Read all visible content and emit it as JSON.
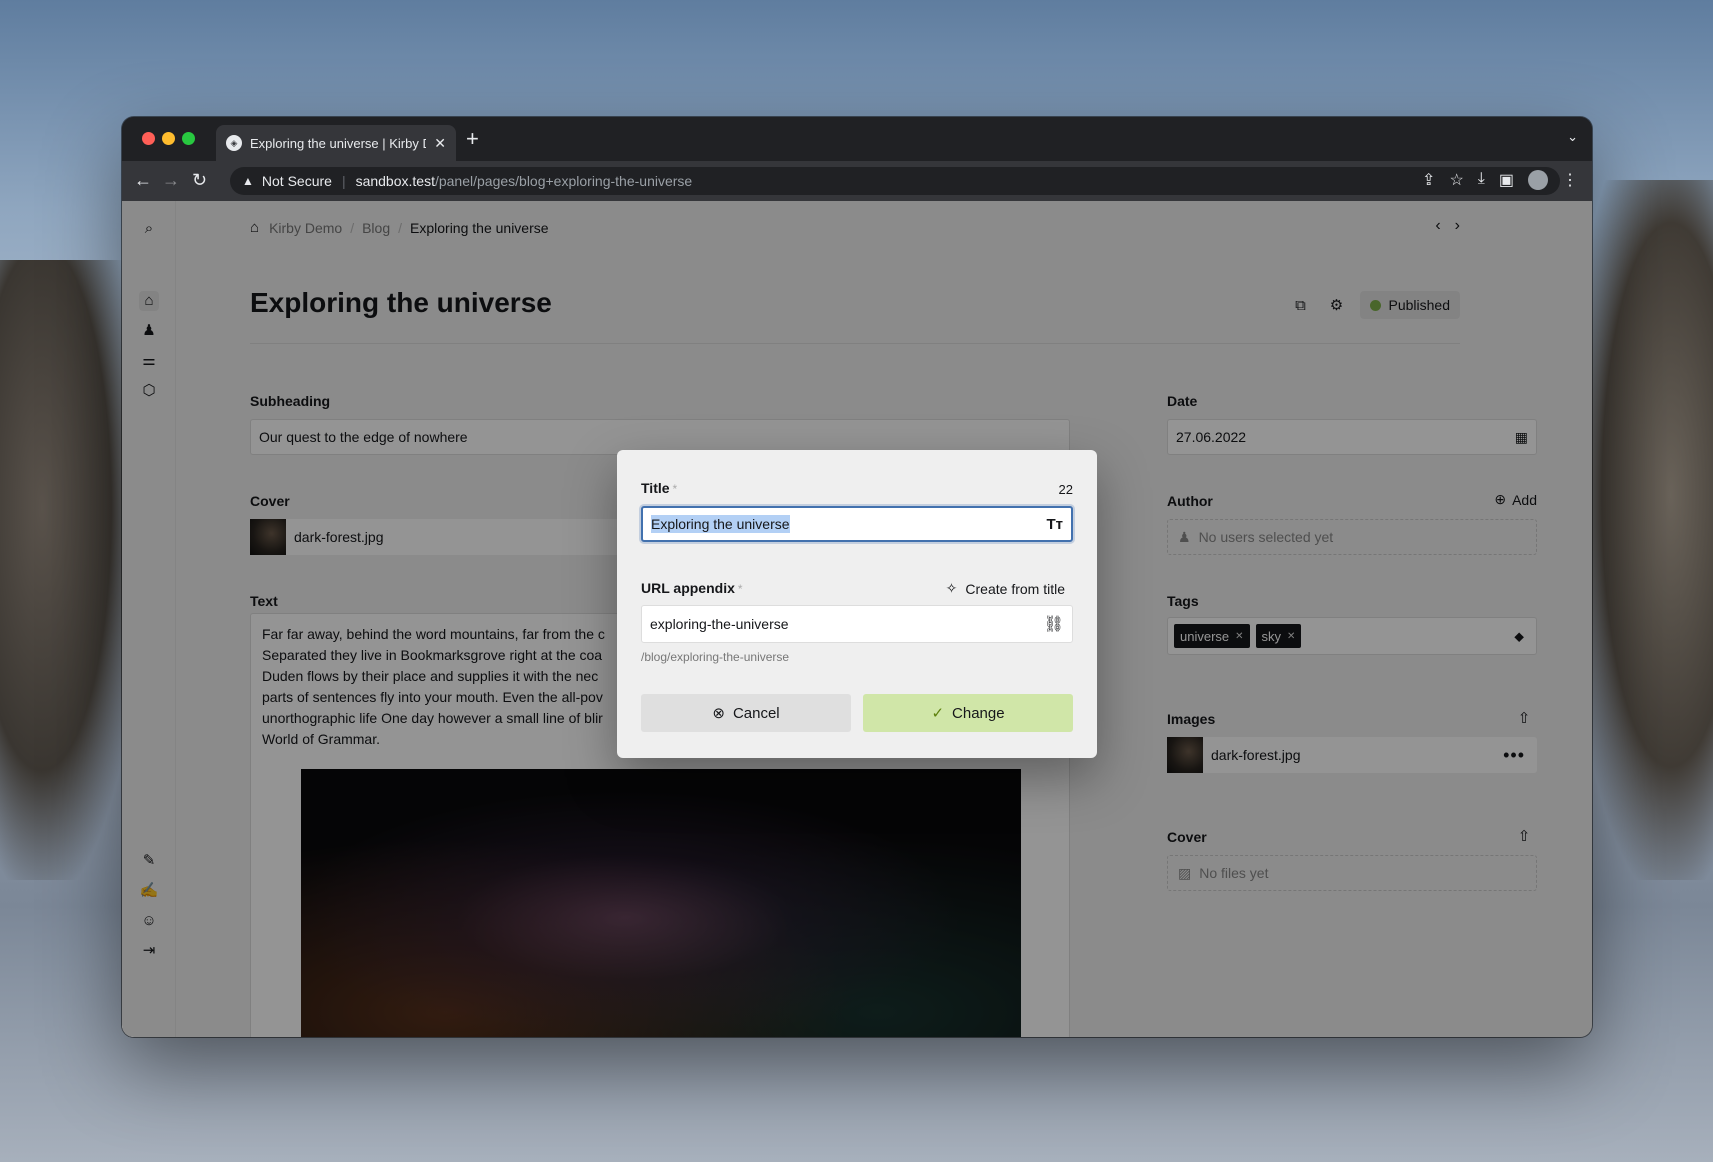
{
  "browser": {
    "tab_title": "Exploring the universe | Kirby D",
    "tab_close": "✕",
    "new_tab": "+",
    "not_secure": "Not Secure",
    "url_host": "sandbox.test",
    "url_path": "/panel/pages/blog+exploring-the-universe"
  },
  "breadcrumb": [
    "Kirby Demo",
    "Blog",
    "Exploring the universe"
  ],
  "page": {
    "title": "Exploring the universe",
    "status": "Published",
    "status_color": "#7fb04a"
  },
  "fields": {
    "subheading_label": "Subheading",
    "subheading_value": "Our quest to the edge of nowhere",
    "cover_label": "Cover",
    "cover_file": "dark-forest.jpg",
    "text_label": "Text",
    "text_lines": [
      "Far far away, behind the word mountains, far from the c",
      "Separated they live in Bookmarksgrove right at the coa",
      "Duden flows by their place and supplies it with the nec",
      "parts of sentences fly into your mouth. Even the all-pov",
      "unorthographic life One day however a small line of blir",
      "World of Grammar."
    ],
    "date_label": "Date",
    "date_value": "27.06.2022",
    "author_label": "Author",
    "author_add": "Add",
    "author_empty": "No users selected yet",
    "tags_label": "Tags",
    "tags": [
      "universe",
      "sky"
    ],
    "images_label": "Images",
    "images_file": "dark-forest.jpg",
    "cover2_label": "Cover",
    "cover2_empty": "No files yet"
  },
  "dialog": {
    "title_label": "Title",
    "required_mark": "*",
    "counter": "22",
    "title_value": "Exploring the universe",
    "url_label": "URL appendix",
    "create_from_title": "Create from title",
    "slug_value": "exploring-the-universe",
    "slug_help": "/blog/exploring-the-universe",
    "cancel": "Cancel",
    "change": "Change",
    "accent_color": "#4271ae",
    "change_bg": "#d0e6a8"
  }
}
